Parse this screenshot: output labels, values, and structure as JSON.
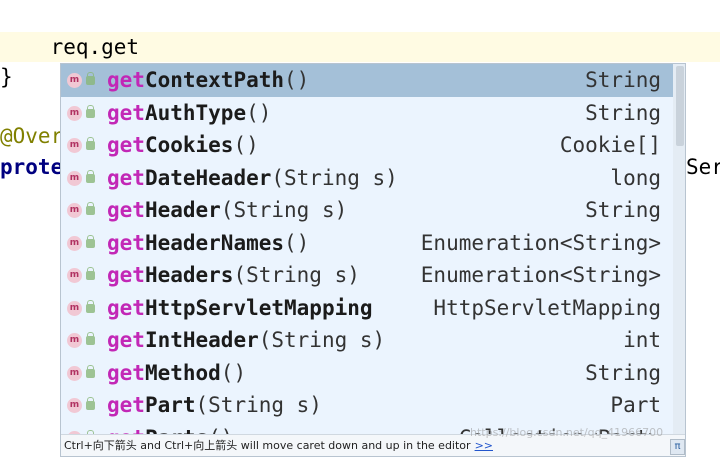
{
  "editor": {
    "current_line": "    req.get",
    "brace": "}",
    "annotation": "@Over",
    "protected": "prote",
    "right_fragment": "Ser"
  },
  "popup": {
    "items": [
      {
        "prefix": "get",
        "name": "ContextPath",
        "params": "()",
        "return": "String"
      },
      {
        "prefix": "get",
        "name": "AuthType",
        "params": "()",
        "return": "String"
      },
      {
        "prefix": "get",
        "name": "Cookies",
        "params": "()",
        "return": "Cookie[]"
      },
      {
        "prefix": "get",
        "name": "DateHeader",
        "params": "(String s)",
        "return": "long"
      },
      {
        "prefix": "get",
        "name": "Header",
        "params": "(String s)",
        "return": "String"
      },
      {
        "prefix": "get",
        "name": "HeaderNames",
        "params": "()",
        "return": "Enumeration<String>"
      },
      {
        "prefix": "get",
        "name": "Headers",
        "params": "(String s)",
        "return": "Enumeration<String>"
      },
      {
        "prefix": "get",
        "name": "HttpServletMapping",
        "params": "",
        "return": "HttpServletMapping"
      },
      {
        "prefix": "get",
        "name": "IntHeader",
        "params": "(String s)",
        "return": "int"
      },
      {
        "prefix": "get",
        "name": "Method",
        "params": "()",
        "return": "String"
      },
      {
        "prefix": "get",
        "name": "Part",
        "params": "(String s)",
        "return": "Part"
      },
      {
        "prefix": "get",
        "name": "Parts",
        "params": "()",
        "return": "Collection<Part>"
      }
    ],
    "hint_text": "Ctrl+向下箭头 and Ctrl+向上箭头 will move caret down and up in the editor",
    "hint_link": ">>",
    "pi_label": "π",
    "method_icon_letter": "m"
  },
  "watermark": "https://blog.csdn.net/qq_41966700"
}
